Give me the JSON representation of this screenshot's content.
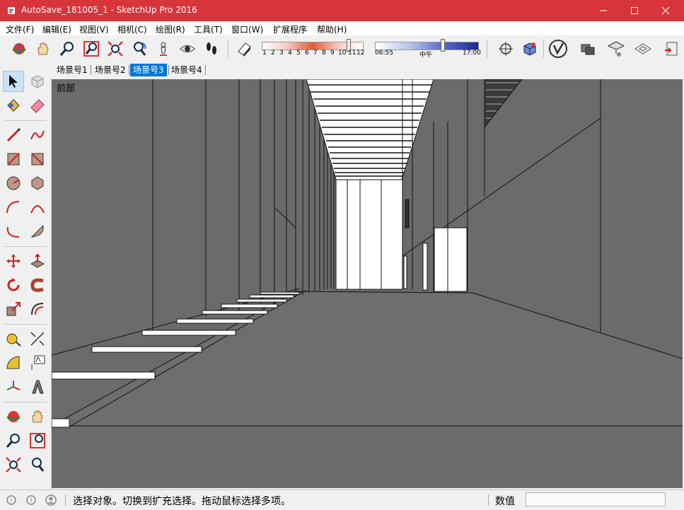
{
  "window": {
    "title": "AutoSave_181005_1 - SketchUp Pro 2016",
    "controls": [
      "minimize-icon",
      "maximize-icon",
      "close-icon"
    ]
  },
  "menu": [
    "文件(F)",
    "编辑(E)",
    "视图(V)",
    "相机(C)",
    "绘图(R)",
    "工具(T)",
    "窗口(W)",
    "扩展程序",
    "帮助(H)"
  ],
  "toolbar": {
    "camera_icons": [
      "orbit-icon",
      "pan-icon",
      "zoom-icon",
      "zoom-window-icon",
      "zoom-extents-icon",
      "previous-view-icon",
      "position-camera-icon",
      "look-around-icon",
      "walk-icon"
    ],
    "shadow_icon": "shadow-settings-icon",
    "months": [
      "1",
      "2",
      "3",
      "4",
      "5",
      "6",
      "7",
      "8",
      "9",
      "10",
      "11",
      "12"
    ],
    "time_start": "06:55",
    "time_mid": "中午",
    "time_end": "17:00",
    "right_icons": [
      "section-plane-icon",
      "component-icon",
      "vray-icon",
      "material-stack-icon",
      "warehouse-icon",
      "layout-icon",
      "extension-icon"
    ]
  },
  "tabs": [
    {
      "label": "场景号1",
      "active": false
    },
    {
      "label": "场景号2",
      "active": false
    },
    {
      "label": "场景号3",
      "active": true
    },
    {
      "label": "场景号4",
      "active": false
    }
  ],
  "viewport": {
    "view_label": "前部"
  },
  "status": {
    "text": "选择对象。切换到扩充选择。拖动鼠标选择多项。",
    "measure_label": "数值",
    "measure_value": "",
    "icons": [
      "geo-location-icon",
      "credits-icon",
      "user-icon"
    ]
  },
  "colors": {
    "title_bar": "#d8343b",
    "active_tab": "#0078d7",
    "viewport_bg": "#6b6b6b"
  }
}
